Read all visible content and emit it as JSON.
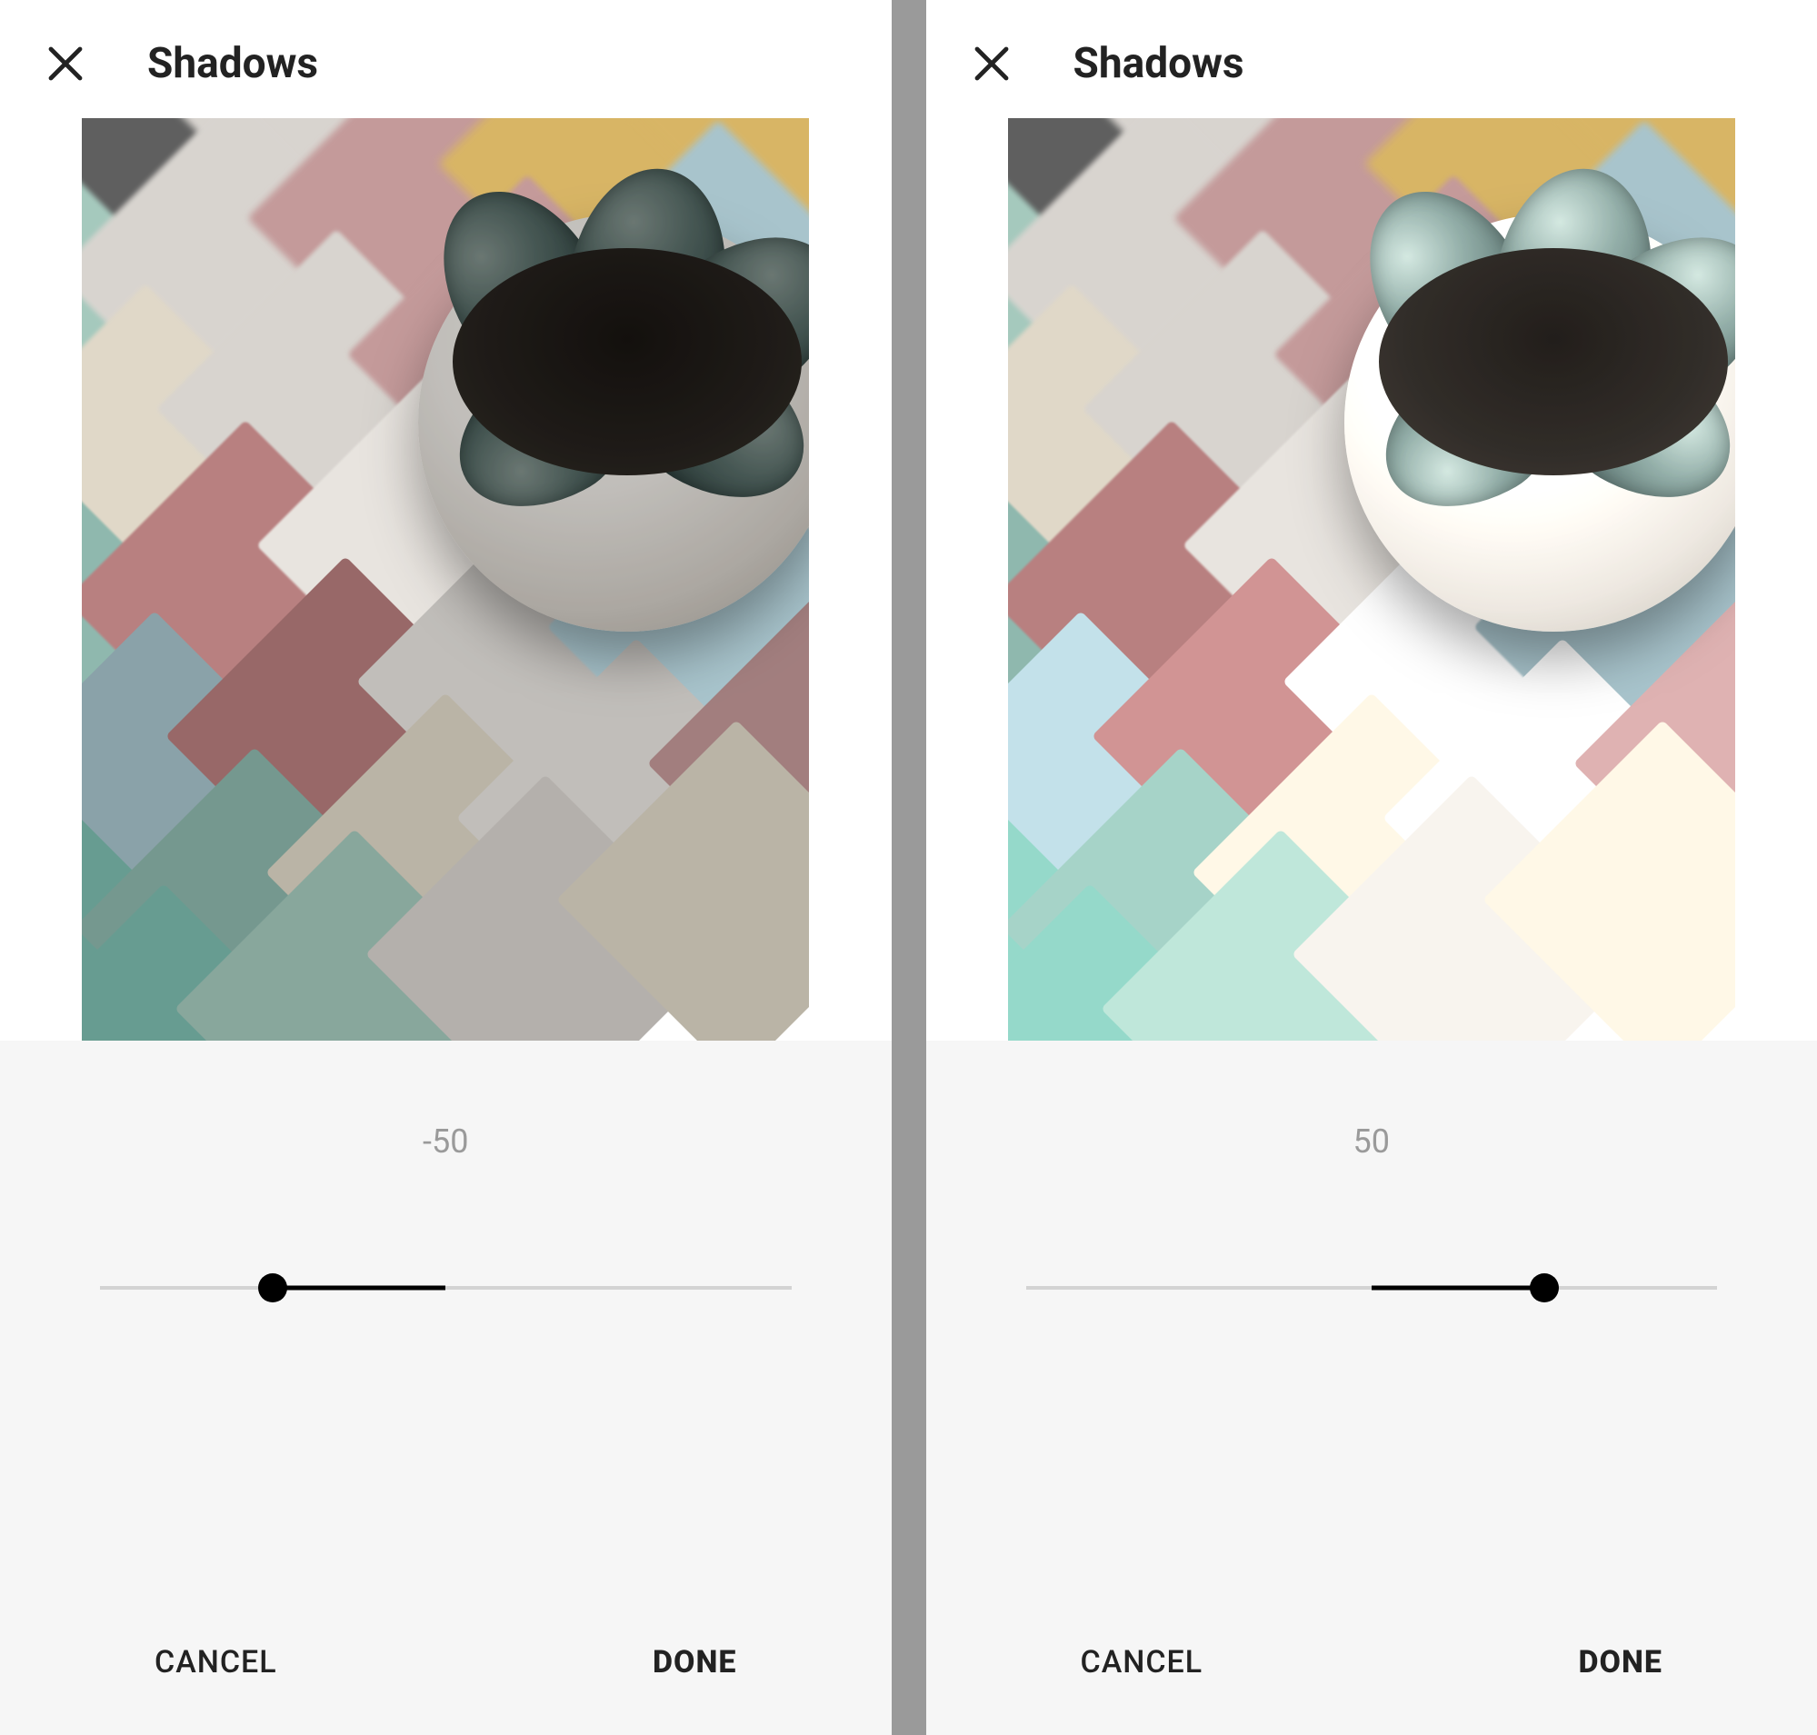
{
  "screens": [
    {
      "title": "Shadows",
      "slider": {
        "value": -50,
        "min": -100,
        "max": 100,
        "display": "-50"
      },
      "footer": {
        "cancel": "CANCEL",
        "done": "DONE"
      },
      "brightness": "dark"
    },
    {
      "title": "Shadows",
      "slider": {
        "value": 50,
        "min": -100,
        "max": 100,
        "display": "50"
      },
      "footer": {
        "cancel": "CANCEL",
        "done": "DONE"
      },
      "brightness": "light"
    }
  ],
  "tile_colors": {
    "grey": "#6a6a6a",
    "lightgrey": "#d8d4cf",
    "white": "#e8e4df",
    "yellow": "#d8b565",
    "pink": "#c49a9a",
    "rose": "#b88080",
    "teal": "#8fb8ae",
    "mint": "#a5c9bd",
    "aqua": "#7fbdb0",
    "blue": "#a8c4cc",
    "cream": "#e0d8c8"
  }
}
